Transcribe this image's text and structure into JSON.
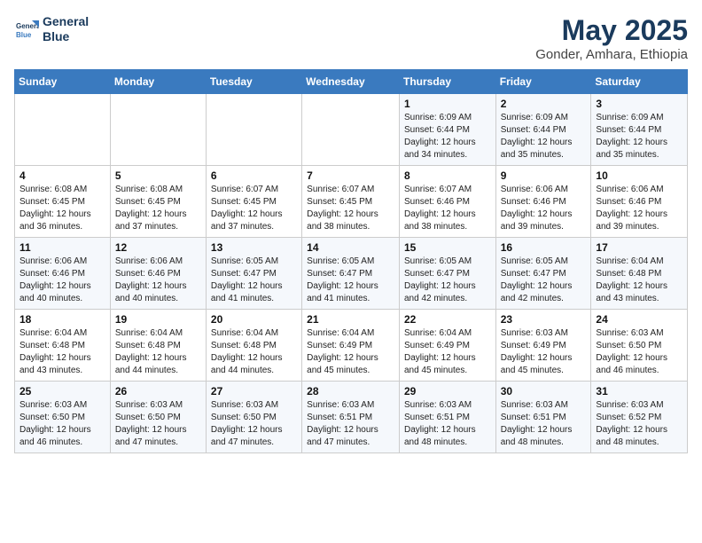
{
  "header": {
    "logo_line1": "General",
    "logo_line2": "Blue",
    "month": "May 2025",
    "location": "Gonder, Amhara, Ethiopia"
  },
  "weekdays": [
    "Sunday",
    "Monday",
    "Tuesday",
    "Wednesday",
    "Thursday",
    "Friday",
    "Saturday"
  ],
  "weeks": [
    [
      {
        "day": "",
        "info": ""
      },
      {
        "day": "",
        "info": ""
      },
      {
        "day": "",
        "info": ""
      },
      {
        "day": "",
        "info": ""
      },
      {
        "day": "1",
        "info": "Sunrise: 6:09 AM\nSunset: 6:44 PM\nDaylight: 12 hours\nand 34 minutes."
      },
      {
        "day": "2",
        "info": "Sunrise: 6:09 AM\nSunset: 6:44 PM\nDaylight: 12 hours\nand 35 minutes."
      },
      {
        "day": "3",
        "info": "Sunrise: 6:09 AM\nSunset: 6:44 PM\nDaylight: 12 hours\nand 35 minutes."
      }
    ],
    [
      {
        "day": "4",
        "info": "Sunrise: 6:08 AM\nSunset: 6:45 PM\nDaylight: 12 hours\nand 36 minutes."
      },
      {
        "day": "5",
        "info": "Sunrise: 6:08 AM\nSunset: 6:45 PM\nDaylight: 12 hours\nand 37 minutes."
      },
      {
        "day": "6",
        "info": "Sunrise: 6:07 AM\nSunset: 6:45 PM\nDaylight: 12 hours\nand 37 minutes."
      },
      {
        "day": "7",
        "info": "Sunrise: 6:07 AM\nSunset: 6:45 PM\nDaylight: 12 hours\nand 38 minutes."
      },
      {
        "day": "8",
        "info": "Sunrise: 6:07 AM\nSunset: 6:46 PM\nDaylight: 12 hours\nand 38 minutes."
      },
      {
        "day": "9",
        "info": "Sunrise: 6:06 AM\nSunset: 6:46 PM\nDaylight: 12 hours\nand 39 minutes."
      },
      {
        "day": "10",
        "info": "Sunrise: 6:06 AM\nSunset: 6:46 PM\nDaylight: 12 hours\nand 39 minutes."
      }
    ],
    [
      {
        "day": "11",
        "info": "Sunrise: 6:06 AM\nSunset: 6:46 PM\nDaylight: 12 hours\nand 40 minutes."
      },
      {
        "day": "12",
        "info": "Sunrise: 6:06 AM\nSunset: 6:46 PM\nDaylight: 12 hours\nand 40 minutes."
      },
      {
        "day": "13",
        "info": "Sunrise: 6:05 AM\nSunset: 6:47 PM\nDaylight: 12 hours\nand 41 minutes."
      },
      {
        "day": "14",
        "info": "Sunrise: 6:05 AM\nSunset: 6:47 PM\nDaylight: 12 hours\nand 41 minutes."
      },
      {
        "day": "15",
        "info": "Sunrise: 6:05 AM\nSunset: 6:47 PM\nDaylight: 12 hours\nand 42 minutes."
      },
      {
        "day": "16",
        "info": "Sunrise: 6:05 AM\nSunset: 6:47 PM\nDaylight: 12 hours\nand 42 minutes."
      },
      {
        "day": "17",
        "info": "Sunrise: 6:04 AM\nSunset: 6:48 PM\nDaylight: 12 hours\nand 43 minutes."
      }
    ],
    [
      {
        "day": "18",
        "info": "Sunrise: 6:04 AM\nSunset: 6:48 PM\nDaylight: 12 hours\nand 43 minutes."
      },
      {
        "day": "19",
        "info": "Sunrise: 6:04 AM\nSunset: 6:48 PM\nDaylight: 12 hours\nand 44 minutes."
      },
      {
        "day": "20",
        "info": "Sunrise: 6:04 AM\nSunset: 6:48 PM\nDaylight: 12 hours\nand 44 minutes."
      },
      {
        "day": "21",
        "info": "Sunrise: 6:04 AM\nSunset: 6:49 PM\nDaylight: 12 hours\nand 45 minutes."
      },
      {
        "day": "22",
        "info": "Sunrise: 6:04 AM\nSunset: 6:49 PM\nDaylight: 12 hours\nand 45 minutes."
      },
      {
        "day": "23",
        "info": "Sunrise: 6:03 AM\nSunset: 6:49 PM\nDaylight: 12 hours\nand 45 minutes."
      },
      {
        "day": "24",
        "info": "Sunrise: 6:03 AM\nSunset: 6:50 PM\nDaylight: 12 hours\nand 46 minutes."
      }
    ],
    [
      {
        "day": "25",
        "info": "Sunrise: 6:03 AM\nSunset: 6:50 PM\nDaylight: 12 hours\nand 46 minutes."
      },
      {
        "day": "26",
        "info": "Sunrise: 6:03 AM\nSunset: 6:50 PM\nDaylight: 12 hours\nand 47 minutes."
      },
      {
        "day": "27",
        "info": "Sunrise: 6:03 AM\nSunset: 6:50 PM\nDaylight: 12 hours\nand 47 minutes."
      },
      {
        "day": "28",
        "info": "Sunrise: 6:03 AM\nSunset: 6:51 PM\nDaylight: 12 hours\nand 47 minutes."
      },
      {
        "day": "29",
        "info": "Sunrise: 6:03 AM\nSunset: 6:51 PM\nDaylight: 12 hours\nand 48 minutes."
      },
      {
        "day": "30",
        "info": "Sunrise: 6:03 AM\nSunset: 6:51 PM\nDaylight: 12 hours\nand 48 minutes."
      },
      {
        "day": "31",
        "info": "Sunrise: 6:03 AM\nSunset: 6:52 PM\nDaylight: 12 hours\nand 48 minutes."
      }
    ]
  ]
}
